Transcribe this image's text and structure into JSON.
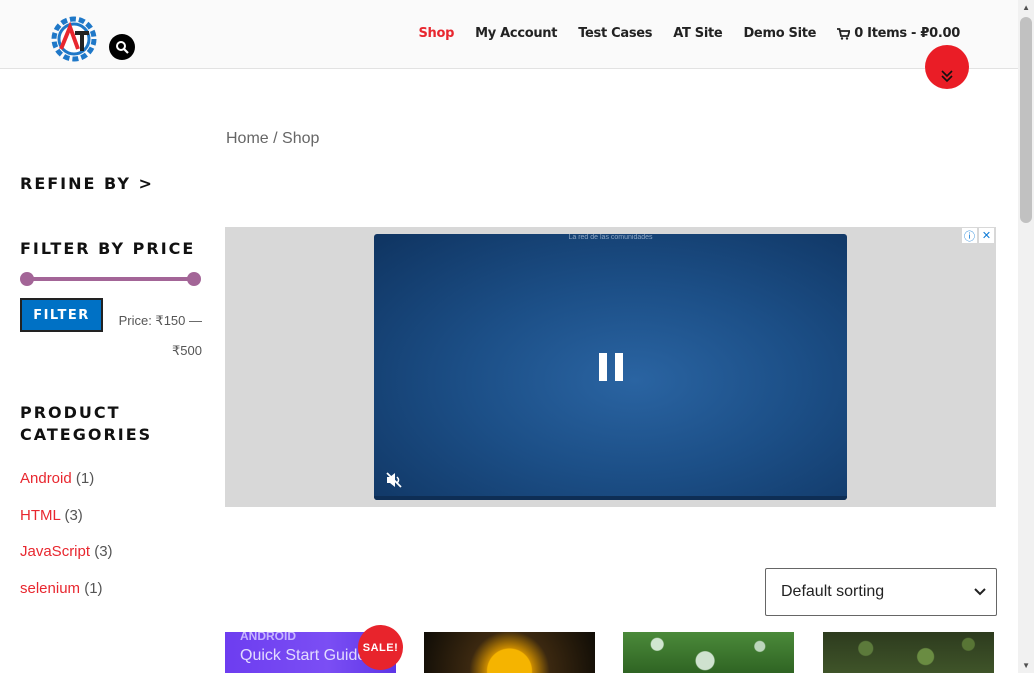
{
  "header": {
    "nav": [
      {
        "label": "Shop",
        "active": true
      },
      {
        "label": "My Account"
      },
      {
        "label": "Test Cases"
      },
      {
        "label": "AT Site"
      },
      {
        "label": "Demo Site"
      }
    ],
    "cart_label": "0 Items - ₽0.00",
    "accent_color": "#e8272f"
  },
  "breadcrumb": {
    "home": "Home",
    "separator": " / ",
    "current": "Shop"
  },
  "sidebar": {
    "refine_title": "REFINE BY >",
    "filter_title": "FILTER BY PRICE",
    "filter_button": "FILTER",
    "price_label": "Price: ₹150 — ₹500",
    "categories_title": "PRODUCT CATEGORIES",
    "categories": [
      {
        "name": "Android",
        "count": "(1)"
      },
      {
        "name": "HTML",
        "count": "(3)"
      },
      {
        "name": "JavaScript",
        "count": "(3)"
      },
      {
        "name": "selenium",
        "count": "(1)"
      }
    ]
  },
  "ad": {
    "caption": "La red de las comunidades"
  },
  "sorting": {
    "selected": "Default sorting"
  },
  "products": [
    {
      "line1": "ANDROID",
      "line2": "Quick Start Guide",
      "badge": "SALE!"
    }
  ]
}
